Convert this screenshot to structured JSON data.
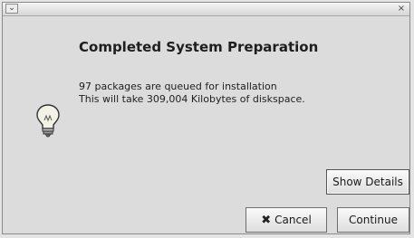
{
  "titlebar": {
    "menu_glyph": "⌄",
    "close_glyph": "×"
  },
  "dialog": {
    "heading": "Completed System Preparation",
    "message_line1": "97 packages are queued for installation",
    "message_line2": "This will take 309,004 Kilobytes of diskspace.",
    "icon": "lightbulb-icon"
  },
  "buttons": {
    "show_details": "Show Details",
    "cancel": "Cancel",
    "cancel_icon": "✖",
    "continue": "Continue"
  }
}
